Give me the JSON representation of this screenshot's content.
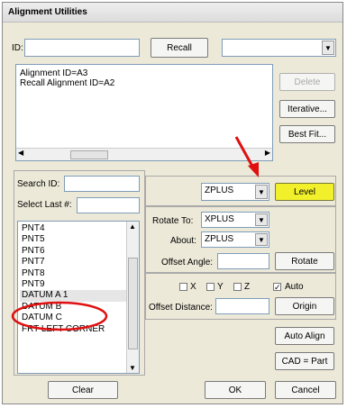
{
  "window": {
    "title": "Alignment Utilities"
  },
  "top": {
    "id_label": "ID:",
    "id_value": "",
    "recall_button": "Recall",
    "recall_combo_value": ""
  },
  "log": {
    "lines": [
      "Alignment ID=A3",
      "Recall Alignment ID=A2"
    ]
  },
  "right_buttons": {
    "delete": "Delete",
    "iterative": "Iterative...",
    "best_fit": "Best Fit..."
  },
  "left": {
    "search_label": "Search ID:",
    "search_value": "",
    "select_last_label": "Select Last #:",
    "select_last_value": "",
    "features": [
      "PNT4",
      "PNT5",
      "PNT6",
      "PNT7",
      "PNT8",
      "PNT9",
      "DATUM A 1",
      "DATUM B",
      "DATUM C",
      "FRT LEFT CORNER"
    ],
    "selected_index": 6,
    "clear_button": "Clear"
  },
  "level": {
    "axis_value": "ZPLUS",
    "level_button": "Level"
  },
  "rotate": {
    "rotate_to_label": "Rotate To:",
    "rotate_to_value": "XPLUS",
    "about_label": "About:",
    "about_value": "ZPLUS",
    "offset_angle_label": "Offset Angle:",
    "offset_angle_value": "",
    "rotate_button": "Rotate"
  },
  "origin": {
    "x_label": "X",
    "y_label": "Y",
    "z_label": "Z",
    "auto_label": "Auto",
    "x_checked": false,
    "y_checked": false,
    "z_checked": false,
    "auto_checked": true,
    "offset_distance_label": "Offset Distance:",
    "offset_distance_value": "",
    "origin_button": "Origin"
  },
  "bottom": {
    "auto_align": "Auto Align",
    "cad_part": "CAD = Part",
    "ok": "OK",
    "cancel": "Cancel"
  },
  "annotation_colors": {
    "red_marker": "#e01010",
    "level_button": "#f2f02a"
  }
}
